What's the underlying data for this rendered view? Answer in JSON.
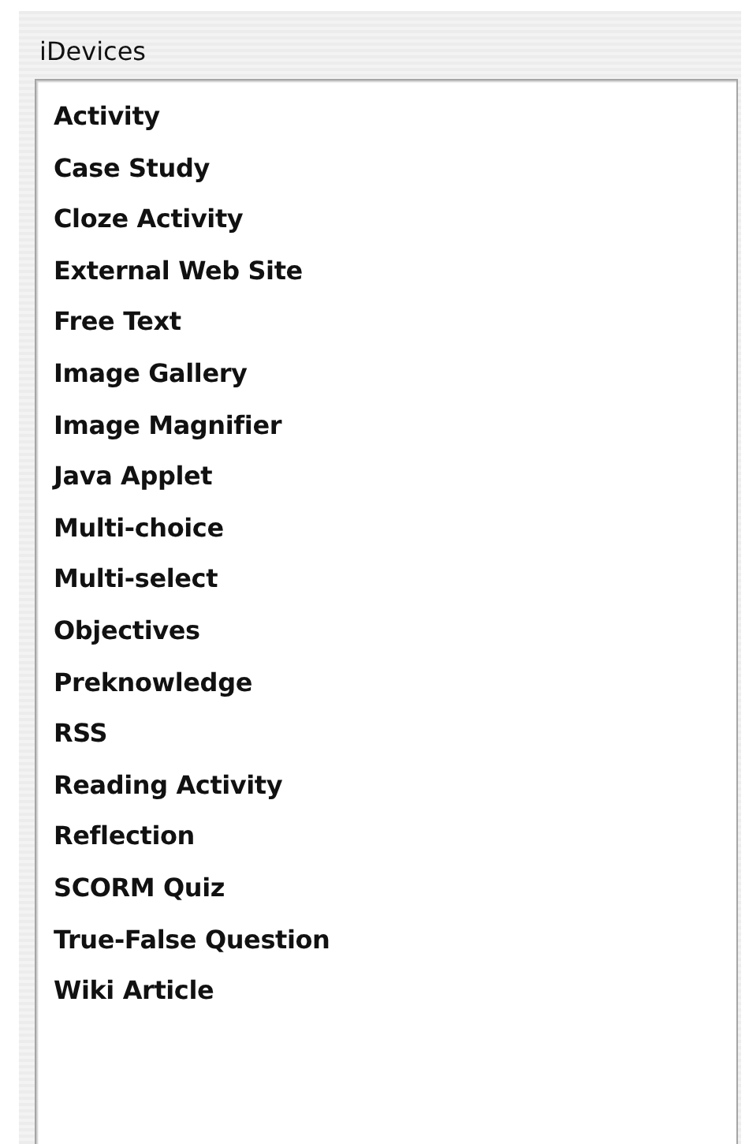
{
  "panel": {
    "title": "iDevices"
  },
  "items": [
    {
      "label": "Activity"
    },
    {
      "label": "Case Study"
    },
    {
      "label": "Cloze Activity"
    },
    {
      "label": "External Web Site"
    },
    {
      "label": "Free Text"
    },
    {
      "label": "Image Gallery"
    },
    {
      "label": "Image Magnifier"
    },
    {
      "label": "Java Applet"
    },
    {
      "label": "Multi-choice"
    },
    {
      "label": "Multi-select"
    },
    {
      "label": "Objectives"
    },
    {
      "label": "Preknowledge"
    },
    {
      "label": "RSS"
    },
    {
      "label": "Reading Activity"
    },
    {
      "label": "Reflection"
    },
    {
      "label": "SCORM Quiz"
    },
    {
      "label": "True-False Question"
    },
    {
      "label": "Wiki Article"
    }
  ]
}
